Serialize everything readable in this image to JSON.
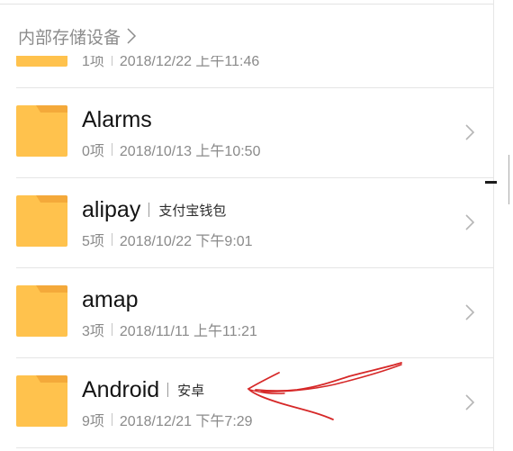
{
  "breadcrumb": {
    "label": "内部存储设备"
  },
  "folders": [
    {
      "count": "1项",
      "date": "2018/12/22 上午11:46"
    },
    {
      "name": "Alarms",
      "count": "0项",
      "date": "2018/10/13 上午10:50"
    },
    {
      "name": "alipay",
      "alias": "支付宝钱包",
      "count": "5项",
      "date": "2018/10/22 下午9:01"
    },
    {
      "name": "amap",
      "count": "3项",
      "date": "2018/11/11 上午11:21"
    },
    {
      "name": "Android",
      "alias": "安卓",
      "count": "9项",
      "date": "2018/12/21 下午7:29"
    }
  ],
  "icons": {
    "folder": "folder-icon",
    "row_chevron": "chevron-right-icon",
    "breadcrumb_chevron": "chevron-right-icon",
    "annotation": "hand-drawn-arrow"
  },
  "colors": {
    "folder_body": "#FFC24D",
    "folder_tab": "#F4A93A",
    "title_text": "#141414",
    "meta_text": "#8A8A8A",
    "breadcrumb_text": "#8C8C8C",
    "divider": "#E5E5E5",
    "annotation": "#D62828"
  }
}
